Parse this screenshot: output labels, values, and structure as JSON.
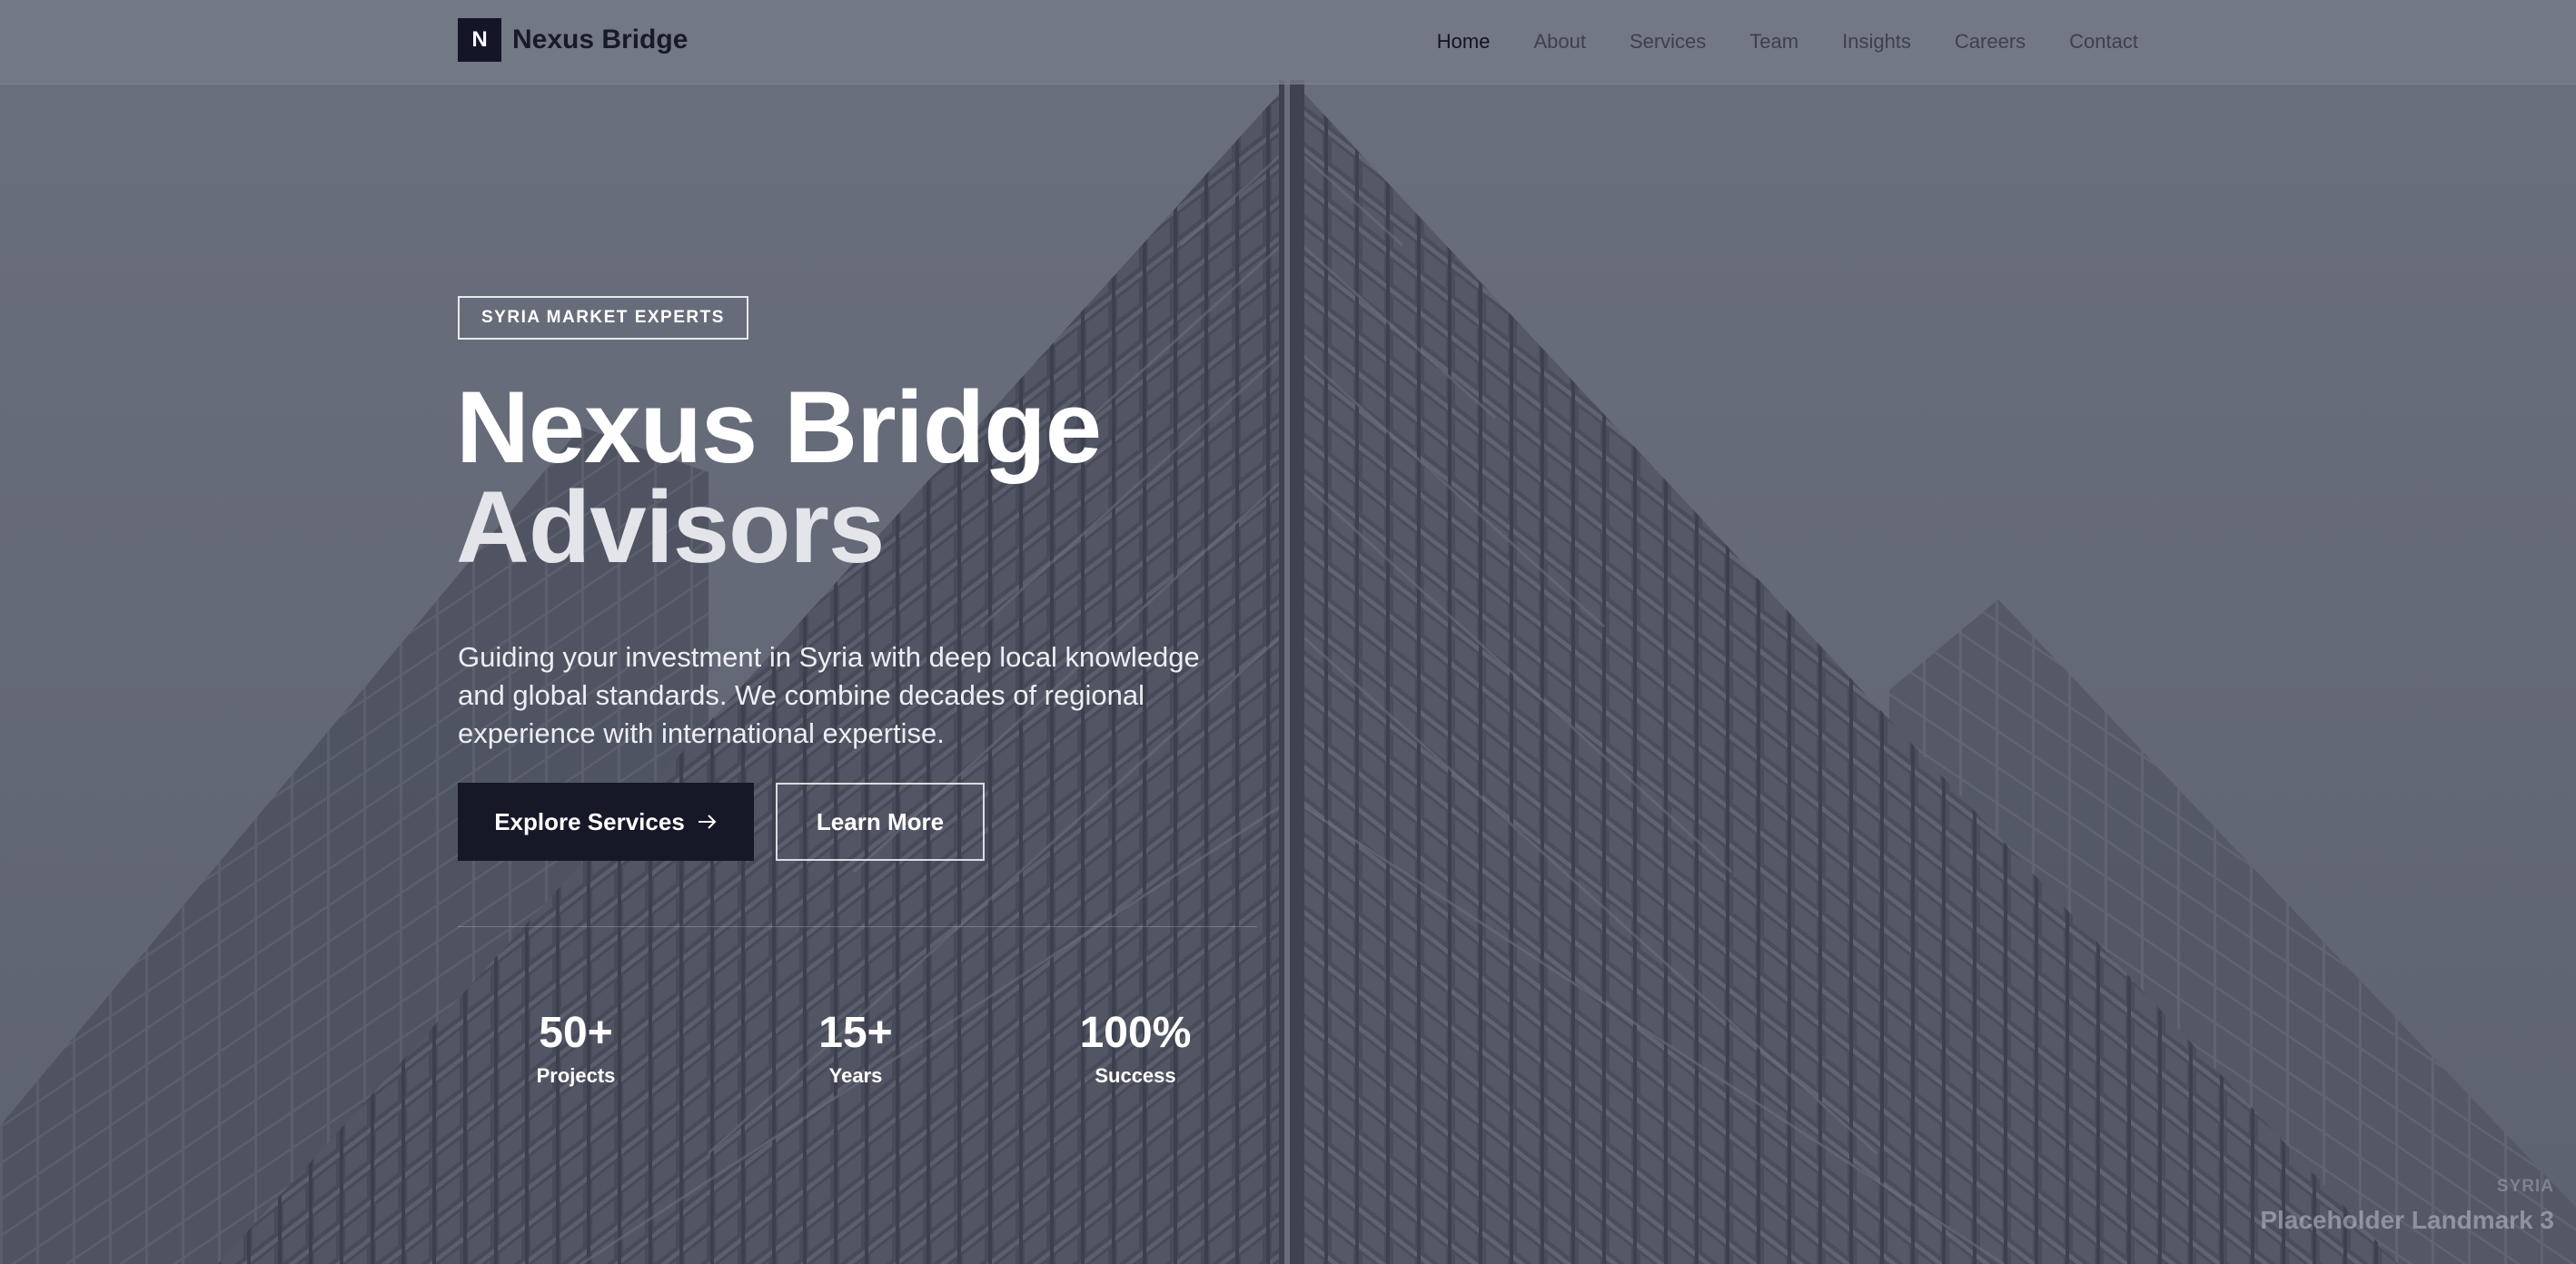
{
  "nav": {
    "logo_letter": "N",
    "brand": "Nexus Bridge",
    "links": [
      {
        "label": "Home",
        "active": true
      },
      {
        "label": "About"
      },
      {
        "label": "Services"
      },
      {
        "label": "Team"
      },
      {
        "label": "Insights"
      },
      {
        "label": "Careers"
      },
      {
        "label": "Contact"
      }
    ]
  },
  "hero": {
    "badge": "SYRIA MARKET EXPERTS",
    "title_line1": "Nexus Bridge",
    "title_line2": "Advisors",
    "subtitle": "Guiding your investment in Syria with deep local knowledge and global standards. We combine decades of regional experience with international expertise.",
    "primary_cta": "Explore Services",
    "primary_cta_icon": "arrow-right-icon",
    "secondary_cta": "Learn More"
  },
  "stats": [
    {
      "value": "50+",
      "label": "Projects"
    },
    {
      "value": "15+",
      "label": "Years"
    },
    {
      "value": "100%",
      "label": "Success"
    }
  ],
  "image_caption": {
    "region": "SYRIA",
    "name": "Placeholder Landmark 3"
  },
  "colors": {
    "primary_dark": "#161828",
    "overlay": "#6b7080",
    "text_light": "#ffffff"
  }
}
